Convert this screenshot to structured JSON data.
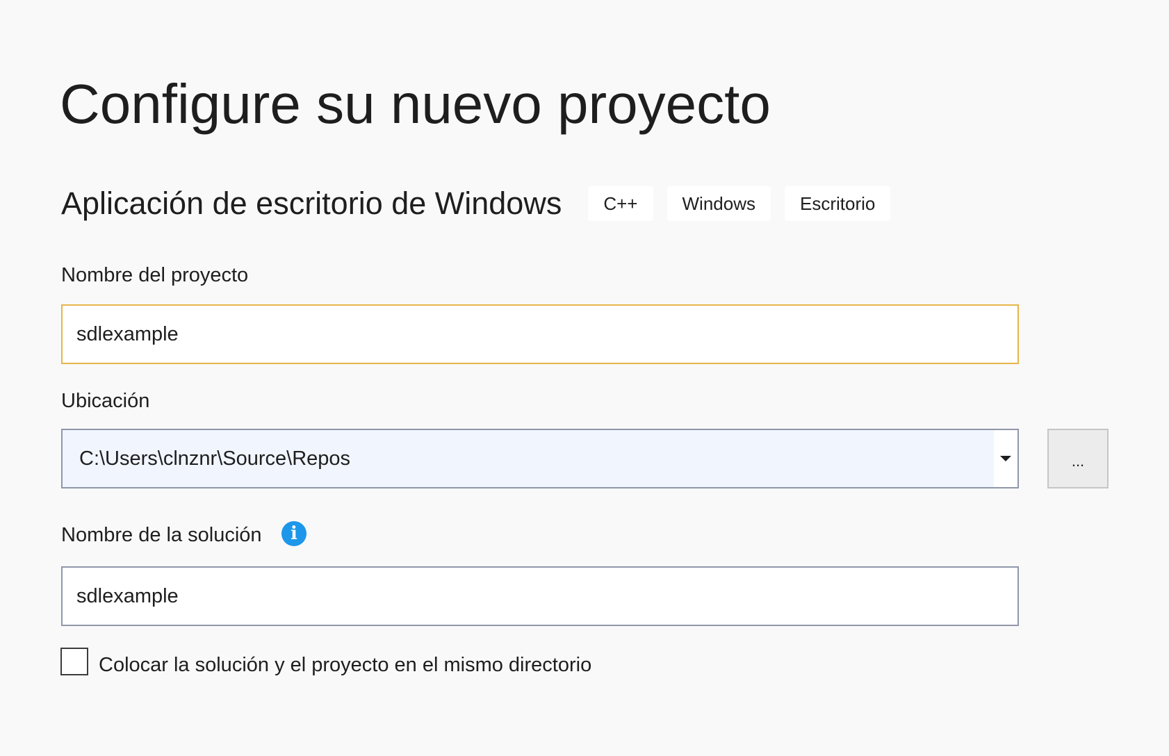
{
  "page": {
    "title": "Configure su nuevo proyecto"
  },
  "template": {
    "name": "Aplicación de escritorio de Windows",
    "tags": [
      "C++",
      "Windows",
      "Escritorio"
    ]
  },
  "project_name": {
    "label": "Nombre del proyecto",
    "value": "sdlexample",
    "focused": true
  },
  "location": {
    "label": "Ubicación",
    "value": "C:\\Users\\clnznr\\Source\\Repos",
    "browse_label": "..."
  },
  "solution_name": {
    "label": "Nombre de la solución",
    "info_icon": "info-icon",
    "value": "sdlexample"
  },
  "same_directory": {
    "label": "Colocar la solución y el proyecto en el mismo directorio",
    "checked": false
  },
  "colors": {
    "background": "#f9f9f9",
    "focus_border": "#e6b54a",
    "info_icon": "#1c97ea",
    "combo_background": "#f1f5fe"
  }
}
